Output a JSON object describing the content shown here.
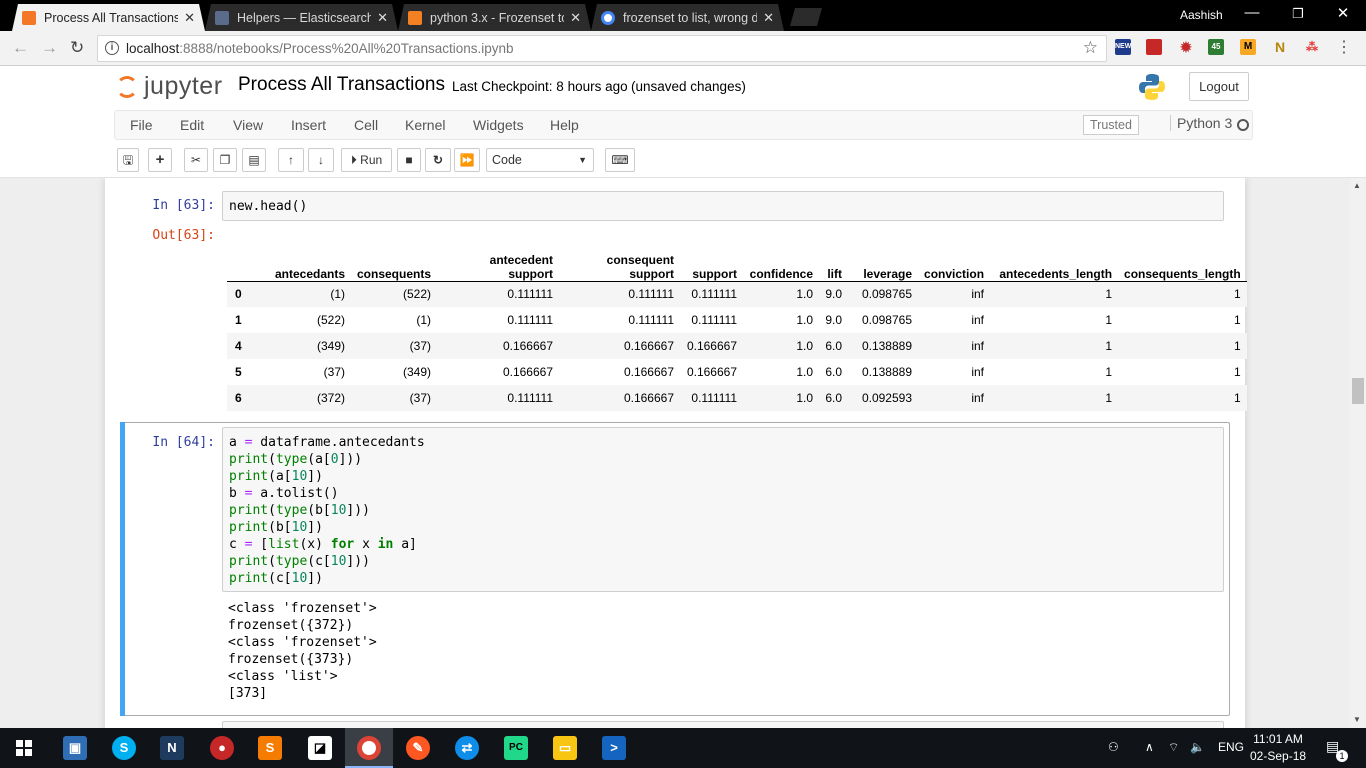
{
  "browser": {
    "tabs": [
      {
        "title": "Process All Transactions",
        "close": "✕",
        "color": "#f37726"
      },
      {
        "title": "Helpers — Elasticsearch",
        "close": "✕",
        "color": "#5a6b8c"
      },
      {
        "title": "python 3.x - Frozenset to",
        "close": "✕",
        "color": "#f48024"
      },
      {
        "title": "frozenset to list, wrong d",
        "close": "✕",
        "color": "#ffffff"
      }
    ],
    "user": "Aashish",
    "url_host": "localhost",
    "url_path": ":8888/notebooks/Process%20All%20Transactions.ipynb",
    "extensions": [
      "NEW",
      "",
      "",
      "45",
      "M",
      "N",
      ""
    ]
  },
  "jupyter": {
    "logo_text": "jupyter",
    "notebook_name": "Process All Transactions",
    "checkpoint": "Last Checkpoint: 8 hours ago",
    "status": "(unsaved changes)",
    "logout": "Logout",
    "menu": [
      "File",
      "Edit",
      "View",
      "Insert",
      "Cell",
      "Kernel",
      "Widgets",
      "Help"
    ],
    "trusted": "Trusted",
    "kernel": "Python 3",
    "toolbar": {
      "run": "Run",
      "cell_type": "Code"
    }
  },
  "cells": {
    "c63": {
      "in_prompt": "In [63]:",
      "out_prompt": "Out[63]:",
      "code": "new.head()",
      "table": {
        "headers": [
          "",
          "antecedants",
          "consequents",
          "antecedent support",
          "consequent support",
          "support",
          "confidence",
          "lift",
          "leverage",
          "conviction",
          "antecedents_length",
          "consequents_length"
        ],
        "rows": [
          [
            "0",
            "(1)",
            "(522)",
            "0.111111",
            "0.111111",
            "0.111111",
            "1.0",
            "9.0",
            "0.098765",
            "inf",
            "1",
            "1"
          ],
          [
            "1",
            "(522)",
            "(1)",
            "0.111111",
            "0.111111",
            "0.111111",
            "1.0",
            "9.0",
            "0.098765",
            "inf",
            "1",
            "1"
          ],
          [
            "4",
            "(349)",
            "(37)",
            "0.166667",
            "0.166667",
            "0.166667",
            "1.0",
            "6.0",
            "0.138889",
            "inf",
            "1",
            "1"
          ],
          [
            "5",
            "(37)",
            "(349)",
            "0.166667",
            "0.166667",
            "0.166667",
            "1.0",
            "6.0",
            "0.138889",
            "inf",
            "1",
            "1"
          ],
          [
            "6",
            "(372)",
            "(37)",
            "0.111111",
            "0.166667",
            "0.111111",
            "1.0",
            "6.0",
            "0.092593",
            "inf",
            "1",
            "1"
          ]
        ]
      }
    },
    "c64": {
      "in_prompt": "In [64]:",
      "output": [
        "<class 'frozenset'>",
        "frozenset({372})",
        "<class 'frozenset'>",
        "frozenset({373})",
        "<class 'list'>",
        "[373]"
      ]
    }
  },
  "taskbar": {
    "lang": "ENG",
    "time": "11:01 AM",
    "date": "02-Sep-18",
    "notifications": "1"
  }
}
